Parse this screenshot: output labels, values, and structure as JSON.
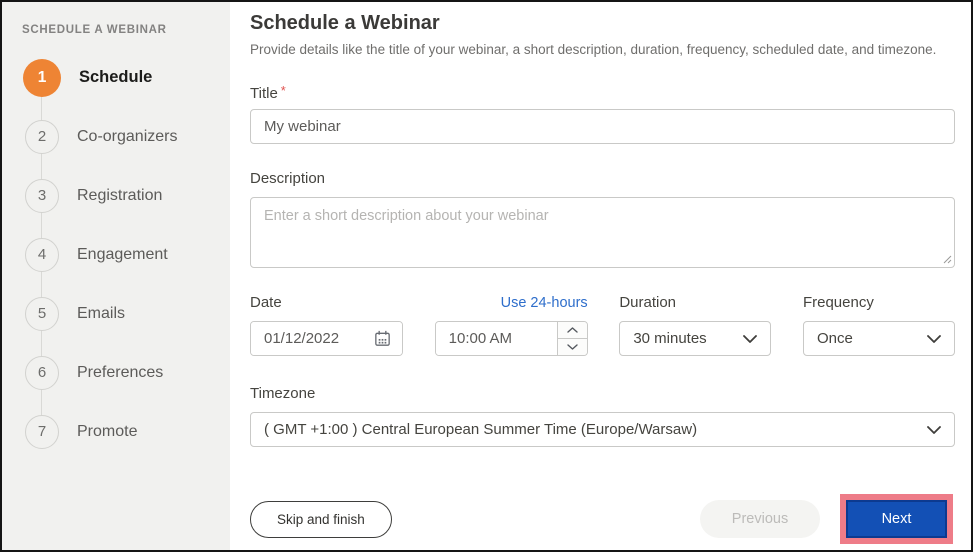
{
  "sidebar": {
    "header": "SCHEDULE A WEBINAR",
    "steps": [
      {
        "num": "1",
        "label": "Schedule",
        "active": true
      },
      {
        "num": "2",
        "label": "Co-organizers",
        "active": false
      },
      {
        "num": "3",
        "label": "Registration",
        "active": false
      },
      {
        "num": "4",
        "label": "Engagement",
        "active": false
      },
      {
        "num": "5",
        "label": "Emails",
        "active": false
      },
      {
        "num": "6",
        "label": "Preferences",
        "active": false
      },
      {
        "num": "7",
        "label": "Promote",
        "active": false
      }
    ]
  },
  "main": {
    "heading": "Schedule a Webinar",
    "subheading": "Provide details like the title of your webinar, a short description, duration, frequency, scheduled date, and timezone.",
    "form": {
      "title": {
        "label": "Title",
        "required_marker": "*",
        "value": "My webinar"
      },
      "description": {
        "label": "Description",
        "placeholder": "Enter a short description about your webinar"
      },
      "date": {
        "label": "Date",
        "value": "01/12/2022"
      },
      "time": {
        "link_24h": "Use 24-hours",
        "value": "10:00 AM"
      },
      "duration": {
        "label": "Duration",
        "value": "30 minutes"
      },
      "frequency": {
        "label": "Frequency",
        "value": "Once"
      },
      "timezone": {
        "label": "Timezone",
        "value": "( GMT +1:00 ) Central European Summer Time (Europe/Warsaw)"
      }
    },
    "footer": {
      "skip": "Skip and finish",
      "previous": "Previous",
      "next": "Next"
    }
  },
  "colors": {
    "step_active_orange": "#ee8434",
    "sidebar_bg": "#f1f1ef",
    "link_blue": "#2e6ecb",
    "next_button_blue": "#1350b5",
    "next_button_border": "#0c3a90",
    "annotation_highlight_pink": "#ee7c88",
    "required_red": "#e0524f"
  },
  "icons": {
    "calendar-icon": "calendar grid glyph",
    "chevron-down-icon": "v",
    "spinner-up-icon": "^",
    "spinner-down-icon": "v",
    "resize-handle-icon": "diagonal grip lines"
  }
}
